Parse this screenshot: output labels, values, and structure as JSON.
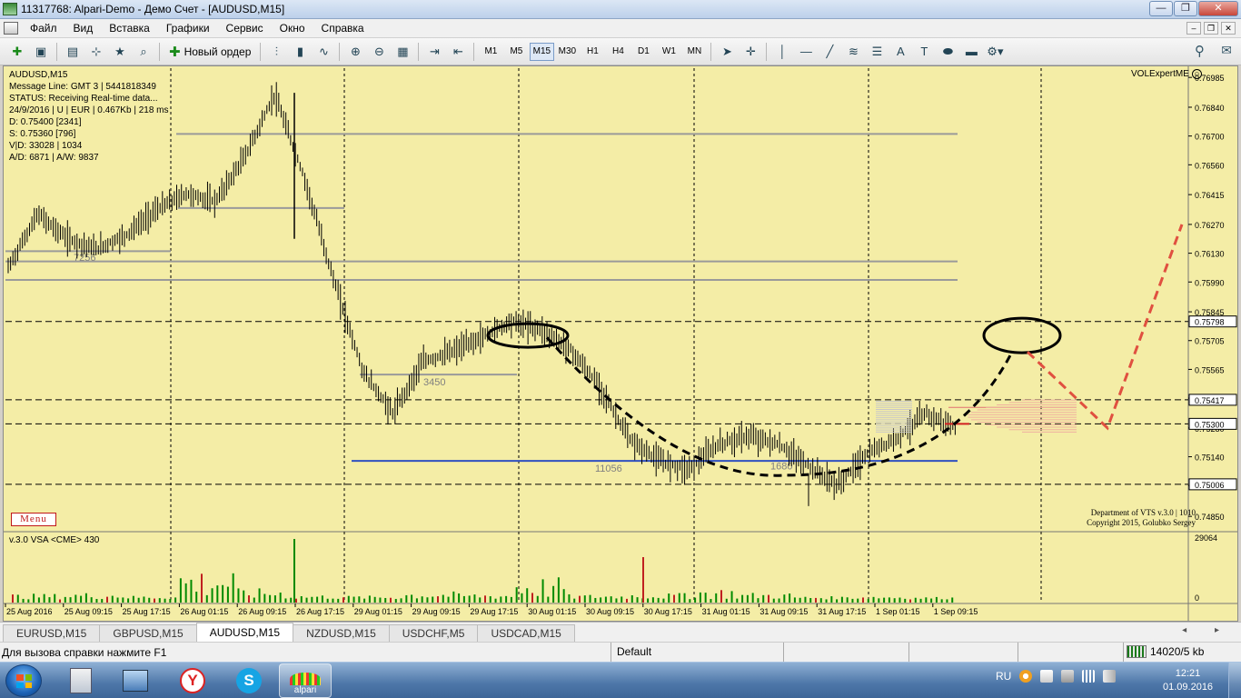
{
  "window": {
    "title": "11317768: Alpari-Demo - Демо Счет - [AUDUSD,M15]",
    "buttons": [
      "—",
      "❐",
      "✕"
    ]
  },
  "menu": {
    "items": [
      "Файл",
      "Вид",
      "Вставка",
      "Графики",
      "Сервис",
      "Окно",
      "Справка"
    ]
  },
  "toolbar": {
    "new_order_label": "Новый ордер",
    "timeframes": [
      "M1",
      "M5",
      "M15",
      "M30",
      "H1",
      "H4",
      "D1",
      "W1",
      "MN"
    ],
    "active_timeframe": "M15",
    "text_tool": "A",
    "label_tool": "T"
  },
  "chart": {
    "symbol_line": "AUDUSD,M15",
    "info_lines": [
      "Message Line: GMT 3 | 5441818349",
      "STATUS:  Receiving Real-time data...",
      "24/9/2016 | U | EUR | 0.467Kb | 218 ms",
      "D: 0.75400  [2341]",
      "S: 0.75360  [796]",
      "V|D: 33028 | 1034",
      "A/D: 6871 | A/W: 9837"
    ],
    "expert_label": "VOLExpertME",
    "menu_button": "Menu",
    "copyright_lines": [
      "Department of VTS  v.3.0 | 1010",
      "Copyright 2015, Golubko Sergey"
    ],
    "volume_labels": [
      "7256",
      "3450",
      "11056",
      "1680"
    ],
    "subwindow_title": "v.3.0 VSA <CME> 430",
    "subwindow_scale": [
      "29064",
      "0"
    ]
  },
  "chart_data": {
    "type": "candlestick",
    "symbol": "AUDUSD",
    "timeframe": "M15",
    "price_axis": [
      "0.76985",
      "0.76840",
      "0.76700",
      "0.76560",
      "0.76415",
      "0.76270",
      "0.76130",
      "0.75990",
      "0.75845",
      "0.75705",
      "0.75565",
      "0.75425",
      "0.75280",
      "0.75140",
      "0.75000",
      "0.74850"
    ],
    "ylim": [
      0.7478,
      0.7703
    ],
    "highlighted_prices": [
      "0.75798",
      "0.75417",
      "0.75300",
      "0.75006"
    ],
    "time_axis": [
      "25 Aug 2016",
      "25 Aug 09:15",
      "25 Aug 17:15",
      "26 Aug 01:15",
      "26 Aug 09:15",
      "26 Aug 17:15",
      "29 Aug 01:15",
      "29 Aug 09:15",
      "29 Aug 17:15",
      "30 Aug 01:15",
      "30 Aug 09:15",
      "30 Aug 17:15",
      "31 Aug 01:15",
      "31 Aug 09:15",
      "31 Aug 17:15",
      "1 Sep 01:15",
      "1 Sep 09:15"
    ],
    "price_path": [
      0.7606,
      0.7632,
      0.762,
      0.7615,
      0.7622,
      0.7634,
      0.7642,
      0.7638,
      0.766,
      0.769,
      0.765,
      0.76,
      0.7555,
      0.7535,
      0.756,
      0.7565,
      0.7572,
      0.758,
      0.7576,
      0.7566,
      0.7548,
      0.7522,
      0.7512,
      0.7508,
      0.752,
      0.7524,
      0.752,
      0.751,
      0.75,
      0.7515,
      0.7523,
      0.7535,
      0.7528
    ],
    "volume_spikes": [
      0.18,
      0.22,
      0.12,
      1.0,
      0.35,
      0.15,
      0.12,
      0.25,
      0.2,
      0.72,
      0.16,
      0.2,
      0.36,
      0.22,
      0.1,
      0.12,
      0.08
    ],
    "colors": {
      "background": "#f4eda6",
      "candles": "#000000",
      "forecast": "#e05040",
      "level_gray": "#9a9a9a",
      "level_blue": "#3050c0",
      "volume": "#008a00",
      "volume_peak": "#c02020"
    }
  },
  "tabs": {
    "items": [
      "EURUSD,M15",
      "GBPUSD,M15",
      "AUDUSD,M15",
      "NZDUSD,M15",
      "USDCHF,M5",
      "USDCAD,M15"
    ],
    "active": "AUDUSD,M15",
    "arrows": "◂ ▸"
  },
  "status": {
    "help": "Для вызова справки нажмите F1",
    "profile": "Default",
    "connection": "14020/5 kb"
  },
  "taskbar": {
    "alpari_label": "alpari",
    "yandex_letter": "Y",
    "skype_letter": "S",
    "lang": "RU",
    "time": "12:21",
    "date": "01.09.2016"
  }
}
